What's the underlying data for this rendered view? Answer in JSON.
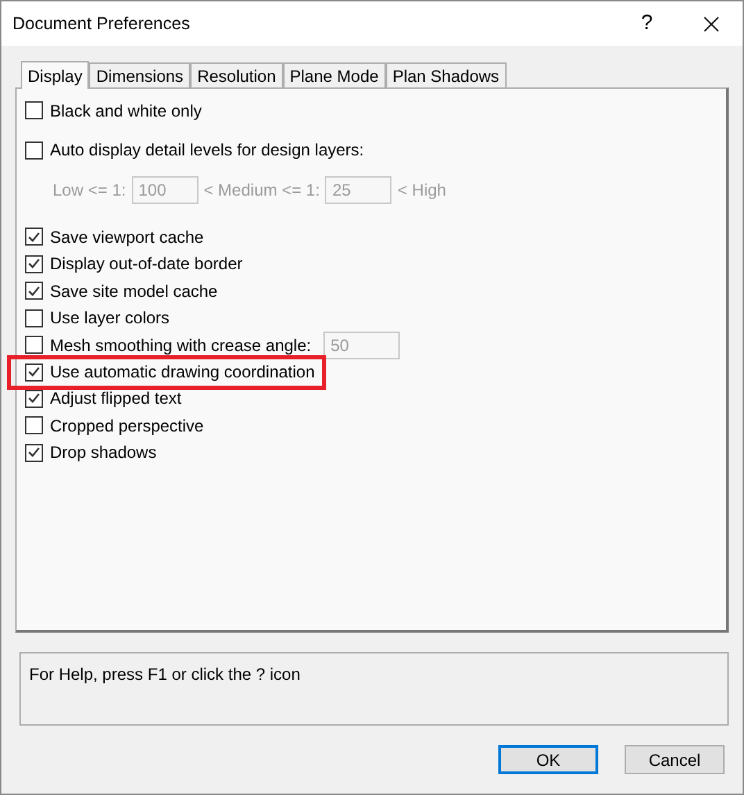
{
  "window": {
    "title": "Document Preferences",
    "help_glyph": "?"
  },
  "tabs": [
    {
      "label": "Display",
      "selected": true
    },
    {
      "label": "Dimensions",
      "selected": false
    },
    {
      "label": "Resolution",
      "selected": false
    },
    {
      "label": "Plane Mode",
      "selected": false
    },
    {
      "label": "Plan Shadows",
      "selected": false
    }
  ],
  "groups": [
    [
      {
        "kind": "checkbox",
        "label": "Black and white only",
        "checked": false,
        "highlighted": false
      }
    ],
    [
      {
        "kind": "checkbox",
        "label": "Auto display detail levels for design layers:",
        "checked": false,
        "highlighted": false
      },
      {
        "kind": "levels",
        "disabled": true,
        "low_label": "Low <= 1:",
        "low_value": "100",
        "medium_label": "< Medium <= 1:",
        "medium_value": "25",
        "high_label": "< High"
      }
    ],
    [
      {
        "kind": "checkbox",
        "label": "Save viewport cache",
        "checked": true,
        "highlighted": false
      },
      {
        "kind": "checkbox",
        "label": "Display out-of-date border",
        "checked": true,
        "highlighted": false
      },
      {
        "kind": "checkbox",
        "label": "Save site model cache",
        "checked": true,
        "highlighted": false
      },
      {
        "kind": "checkbox",
        "label": "Use layer colors",
        "checked": false,
        "highlighted": false
      },
      {
        "kind": "checkbox_field",
        "label": "Mesh smoothing with crease angle:",
        "checked": false,
        "highlighted": false,
        "value": "50",
        "disabled": true
      },
      {
        "kind": "checkbox",
        "label": "Use automatic drawing coordination",
        "checked": true,
        "highlighted": true
      },
      {
        "kind": "checkbox",
        "label": "Adjust flipped text",
        "checked": true,
        "highlighted": false
      },
      {
        "kind": "checkbox",
        "label": "Cropped perspective",
        "checked": false,
        "highlighted": false
      },
      {
        "kind": "checkbox",
        "label": "Drop shadows",
        "checked": true,
        "highlighted": false
      }
    ]
  ],
  "help_text": "For Help, press F1 or click the ? icon",
  "buttons": [
    {
      "label": "OK",
      "default": true
    },
    {
      "label": "Cancel",
      "default": false
    }
  ]
}
